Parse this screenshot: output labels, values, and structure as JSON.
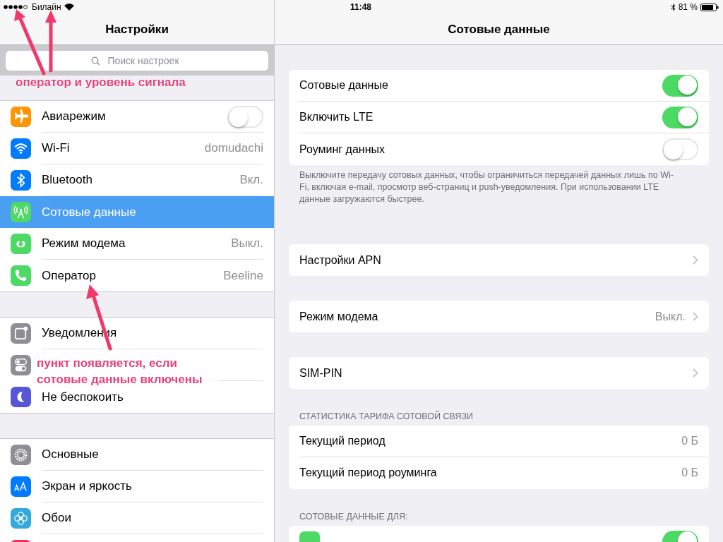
{
  "status_bar": {
    "carrier": "Билайн",
    "time": "11:48",
    "battery": "81 %"
  },
  "sidebar": {
    "title": "Настройки",
    "search": {
      "placeholder": "Поиск настроек"
    },
    "groups": [
      [
        {
          "kind": "toggle",
          "label": "Авиарежим",
          "on": false,
          "selected": false
        },
        {
          "kind": "value",
          "label": "Wi-Fi",
          "value": "domudachi",
          "selected": false
        },
        {
          "kind": "value",
          "label": "Bluetooth",
          "value": "Вкл.",
          "selected": false
        },
        {
          "kind": "value",
          "label": "Сотовые данные",
          "selected": true
        },
        {
          "kind": "value",
          "label": "Режим модема",
          "value": "Выкл.",
          "selected": false
        },
        {
          "kind": "value",
          "label": "Оператор",
          "value": "Beeline",
          "selected": false
        }
      ],
      [
        {
          "kind": "value",
          "label": "Уведомления",
          "selected": false
        },
        {
          "kind": "value",
          "selected": false
        },
        {
          "kind": "value",
          "label": "Не беспокоить",
          "selected": false
        }
      ],
      [
        {
          "kind": "value",
          "label": "Основные",
          "selected": false
        },
        {
          "kind": "value",
          "label": "Экран и яркость",
          "selected": false
        },
        {
          "kind": "value",
          "label": "Обои",
          "selected": false
        },
        {
          "kind": "value",
          "selected": false
        }
      ]
    ]
  },
  "detail": {
    "title": "Сотовые данные",
    "sections": [
      {
        "rows": [
          {
            "kind": "toggle",
            "label": "Сотовые данные",
            "on": true
          },
          {
            "kind": "toggle",
            "label": "Включить LTE",
            "on": true
          },
          {
            "kind": "toggle",
            "label": "Роуминг данных",
            "on": false
          }
        ],
        "footer": "Выключите передачу сотовых данных, чтобы ограничиться передачей данных лишь по Wi-Fi, включая e-mail, просмотр веб-страниц и push-уведомления. При использовании LTE данные загружаются быстрее."
      },
      {
        "rows": [
          {
            "kind": "link",
            "label": "Настройки APN"
          }
        ]
      },
      {
        "rows": [
          {
            "kind": "link",
            "label": "Режим модема",
            "value": "Выкл."
          }
        ]
      },
      {
        "rows": [
          {
            "kind": "link",
            "label": "SIM-PIN"
          }
        ]
      },
      {
        "header": "СТАТИСТИКА ТАРИФА СОТОВОЙ СВЯЗИ",
        "rows": [
          {
            "kind": "value",
            "label": "Текущий период",
            "value": "0 Б"
          },
          {
            "kind": "value",
            "label": "Текущий период роуминга",
            "value": "0 Б"
          }
        ]
      },
      {
        "header": "СОТОВЫЕ ДАННЫЕ ДЛЯ:",
        "rows": [
          {
            "kind": "app_toggle",
            "on": true
          }
        ]
      }
    ]
  },
  "annotations": [
    {
      "text": "оператор и уровень сигнала"
    },
    {
      "text": "пункт появляется, если сотовые данные включены"
    }
  ]
}
